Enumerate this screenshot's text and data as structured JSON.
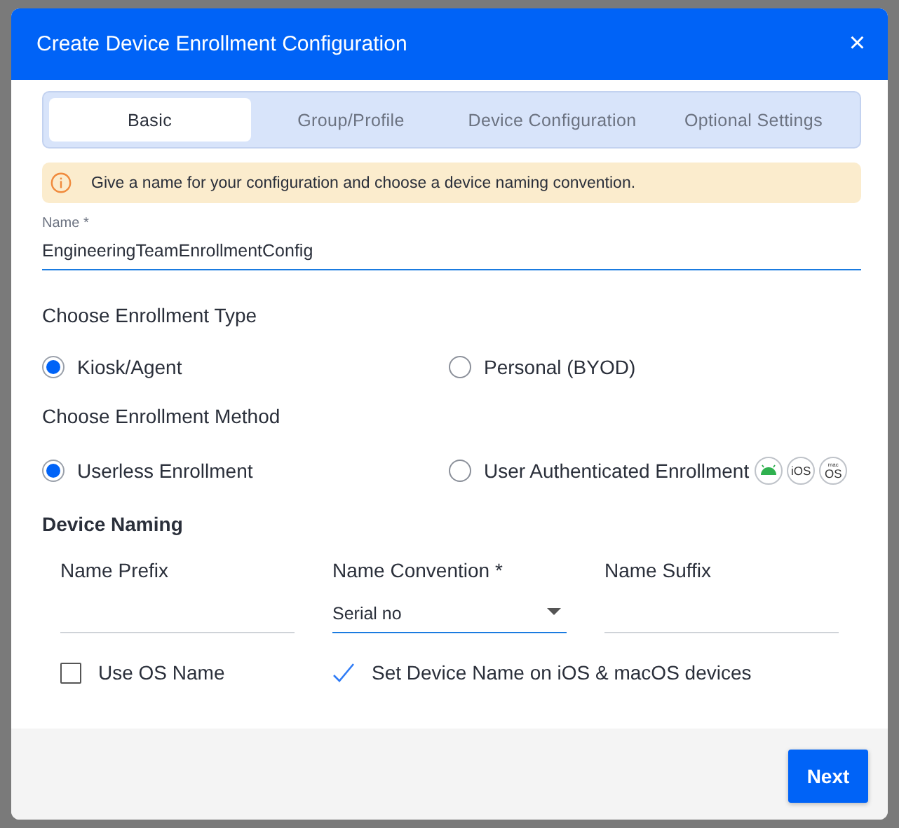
{
  "dialog": {
    "title": "Create Device Enrollment Configuration",
    "close": "×"
  },
  "tabs": [
    {
      "label": "Basic",
      "selected": true
    },
    {
      "label": "Group/Profile",
      "selected": false
    },
    {
      "label": "Device Configuration",
      "selected": false
    },
    {
      "label": "Optional Settings",
      "selected": false
    }
  ],
  "info": "Give a name for your configuration and choose a device naming convention.",
  "name_field": {
    "label": "Name *",
    "value": "EngineeringTeamEnrollmentConfig"
  },
  "enrollment_type": {
    "heading": "Choose Enrollment Type",
    "options": [
      {
        "label": "Kiosk/Agent",
        "selected": true
      },
      {
        "label": "Personal (BYOD)",
        "selected": false
      }
    ]
  },
  "enrollment_method": {
    "heading": "Choose Enrollment Method",
    "options": [
      {
        "label": "Userless Enrollment",
        "selected": true
      },
      {
        "label": "User Authenticated Enrollment",
        "selected": false
      }
    ],
    "platforms": [
      {
        "kind": "android"
      },
      {
        "kind": "text",
        "label": "iOS"
      },
      {
        "kind": "text",
        "top": "mac",
        "label": "OS"
      }
    ]
  },
  "device_naming": {
    "heading": "Device Naming",
    "fields": [
      {
        "kind": "input",
        "label": "Name Prefix"
      },
      {
        "kind": "select",
        "label": "Name Convention *",
        "value": "Serial no"
      },
      {
        "kind": "input",
        "label": "Name Suffix"
      }
    ],
    "checks": [
      {
        "label": "Use OS Name",
        "checked": false
      },
      {
        "label": "Set Device Name on iOS & macOS devices",
        "checked": true
      }
    ]
  },
  "footer": {
    "button": "Next"
  }
}
